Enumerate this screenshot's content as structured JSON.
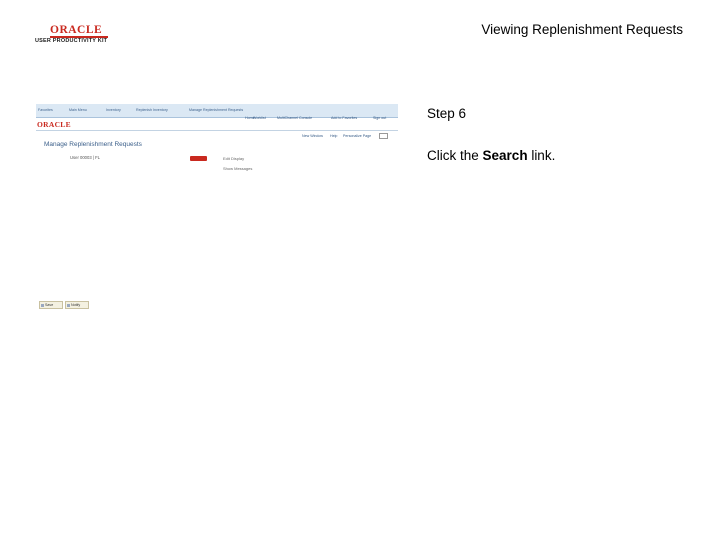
{
  "logo": {
    "brand": "ORACLE",
    "product": "USER PRODUCTIVITY KIT"
  },
  "title": "Viewing Replenishment Requests",
  "step": {
    "label": "Step 6"
  },
  "instruction": {
    "prefix": "Click the ",
    "link": "Search",
    "suffix": " link."
  },
  "screenshot": {
    "breadcrumb": [
      "Favorites",
      "Main Menu",
      "Inventory",
      "Replenish Inventory",
      "Manage Replenishment Requests"
    ],
    "oracle": "ORACLE",
    "topnav": [
      "Home",
      "Worklist",
      "MultiChannel Console",
      "Add to Favorites",
      "Sign out"
    ],
    "toolbar": [
      "New Window",
      "Help",
      "Personalize Page"
    ],
    "page_title": "Manage Replenishment Requests",
    "user": "User 00003 | FL",
    "link_a": "Edit Display",
    "link_b": "Show Messages",
    "save": "Save",
    "notify": "Notify"
  }
}
